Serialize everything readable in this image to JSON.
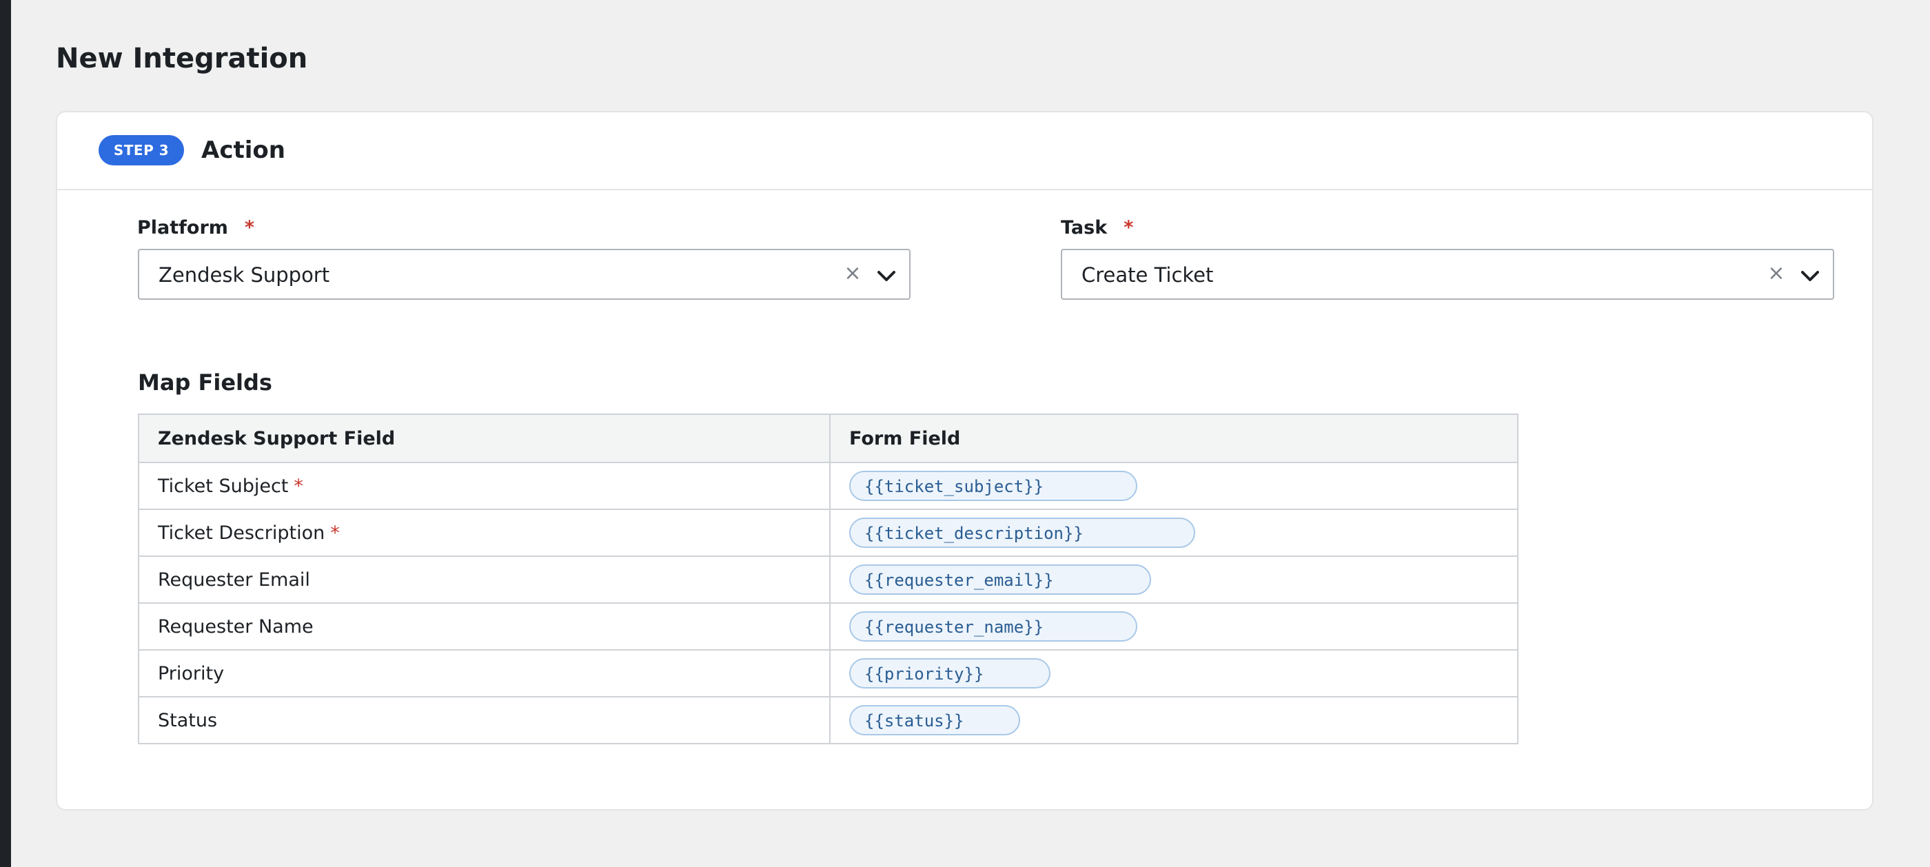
{
  "page": {
    "title": "New Integration"
  },
  "step": {
    "badge": "STEP 3",
    "title": "Action"
  },
  "platform": {
    "label": "Platform",
    "required_mark": "*",
    "value": "Zendesk Support",
    "clear": "×"
  },
  "task": {
    "label": "Task",
    "required_mark": "*",
    "value": "Create Ticket",
    "clear": "×"
  },
  "map_fields": {
    "title": "Map Fields",
    "headers": [
      "Zendesk Support Field",
      "Form Field"
    ],
    "rows": [
      {
        "field": "Ticket Subject",
        "required": "*",
        "token": "{{ticket_subject}}"
      },
      {
        "field": "Ticket Description",
        "required": "*",
        "token": "{{ticket_description}}"
      },
      {
        "field": "Requester Email",
        "required": "",
        "token": "{{requester_email}}"
      },
      {
        "field": "Requester Name",
        "required": "",
        "token": "{{requester_name}}"
      },
      {
        "field": "Priority",
        "required": "",
        "token": "{{priority}}"
      },
      {
        "field": "Status",
        "required": "",
        "token": "{{status}}"
      }
    ]
  },
  "icons": {
    "clear": "close-icon",
    "dropdown": "chevron-down-icon"
  },
  "colors": {
    "accent": "#2c6be0",
    "required": "#c9372c",
    "token_bg": "#edf4fb",
    "token_border": "#a9c8e8"
  }
}
